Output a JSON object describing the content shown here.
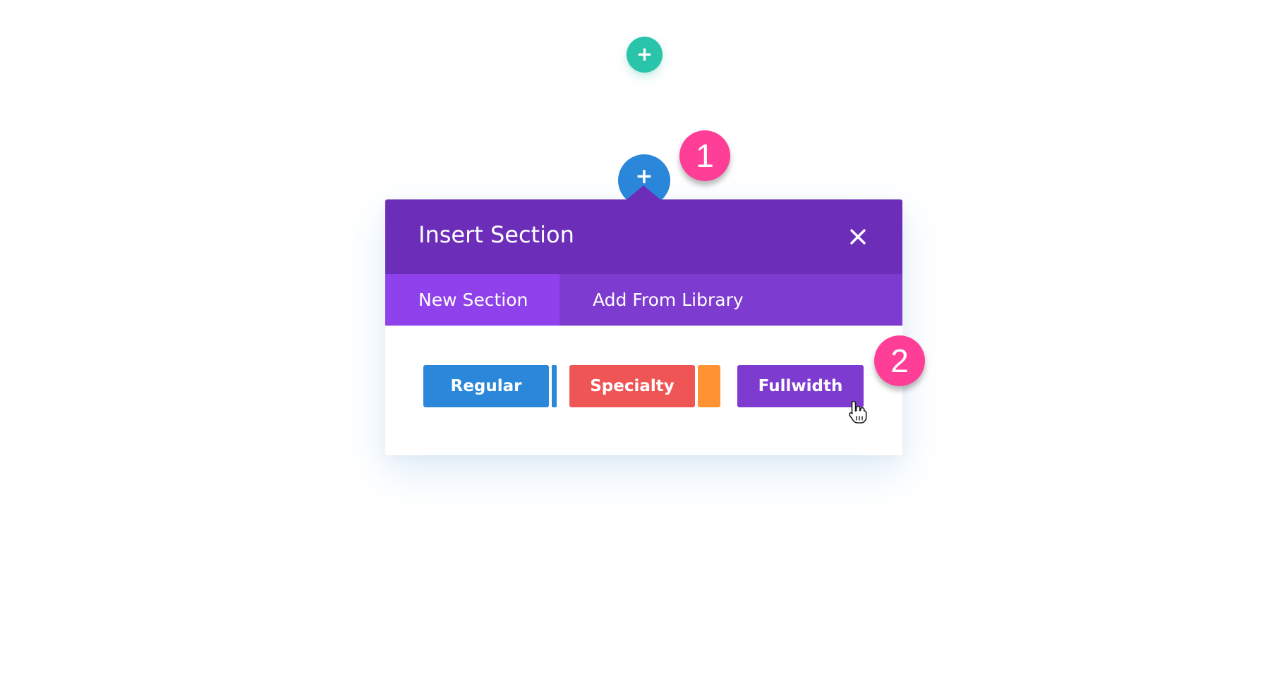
{
  "page": {
    "add_row_button": {
      "icon": "plus-icon",
      "glyph": "+",
      "color": "#29c4a9"
    },
    "add_section_button": {
      "icon": "plus-icon",
      "glyph": "+",
      "color": "#2b87da"
    }
  },
  "annotations": [
    {
      "label": "1",
      "color": "#ff3e98"
    },
    {
      "label": "2",
      "color": "#ff3e98"
    }
  ],
  "modal": {
    "title": "Insert Section",
    "close_icon": "close-icon",
    "header_color": "#6c2eb9",
    "tabs": [
      {
        "label": "New Section",
        "active": true
      },
      {
        "label": "Add From Library",
        "active": false
      }
    ],
    "options": [
      {
        "label": "Regular",
        "color": "#2b87da",
        "accent_color": "#2b87da"
      },
      {
        "label": "Specialty",
        "color": "#ef5555",
        "accent_color": "#ff9232"
      },
      {
        "label": "Fullwidth",
        "color": "#7e3bd0",
        "hovered": true
      }
    ]
  },
  "cursor": {
    "icon": "hand-pointer-icon"
  }
}
